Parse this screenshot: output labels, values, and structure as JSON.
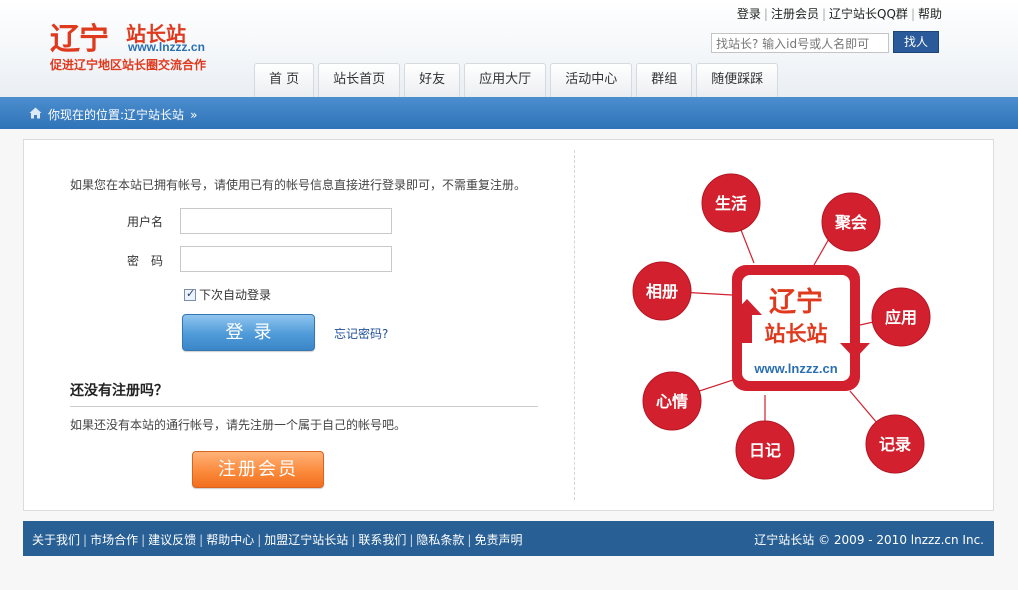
{
  "logo": {
    "part1": "辽宁",
    "part2": "站长站",
    "url": "www.lnzzz.cn",
    "slogan": "促进辽宁地区站长圈交流合作"
  },
  "toplinks": [
    "登录",
    "注册会员",
    "辽宁站长QQ群",
    "帮助"
  ],
  "search": {
    "placeholder": "找站长? 输入id号或人名即可",
    "button": "找人"
  },
  "nav": [
    "首 页",
    "站长首页",
    "好友",
    "应用大厅",
    "活动中心",
    "群组",
    "随便踩踩"
  ],
  "breadcrumb": {
    "label": "你现在的位置:",
    "current": "辽宁站长站",
    "sep": "»"
  },
  "login": {
    "intro": "如果您在本站已拥有帐号，请使用已有的帐号信息直接进行登录即可，不需重复注册。",
    "username_label": "用户名",
    "password_label": "密　码",
    "remember_label": "下次自动登录",
    "remember_checked": true,
    "submit": "登录",
    "forgot": "忘记密码?"
  },
  "register": {
    "heading": "还没有注册吗？",
    "desc": "如果还没有本站的通行帐号，请先注册一个属于自己的帐号吧。",
    "button": "注册会员"
  },
  "diagram": {
    "center_line1": "辽宁",
    "center_line2": "站长站",
    "center_url": "www.lnzzz.cn",
    "nodes": [
      "生活",
      "聚会",
      "相册",
      "应用",
      "心情",
      "日记",
      "记录"
    ],
    "node_color": "#d2202e"
  },
  "footer": {
    "links": [
      "关于我们",
      "市场合作",
      "建议反馈",
      "帮助中心",
      "加盟辽宁站长站",
      "联系我们",
      "隐私条款",
      "免责声明"
    ],
    "copyright": "辽宁站长站  © 2009 - 2010 lnzzz.cn Inc."
  }
}
